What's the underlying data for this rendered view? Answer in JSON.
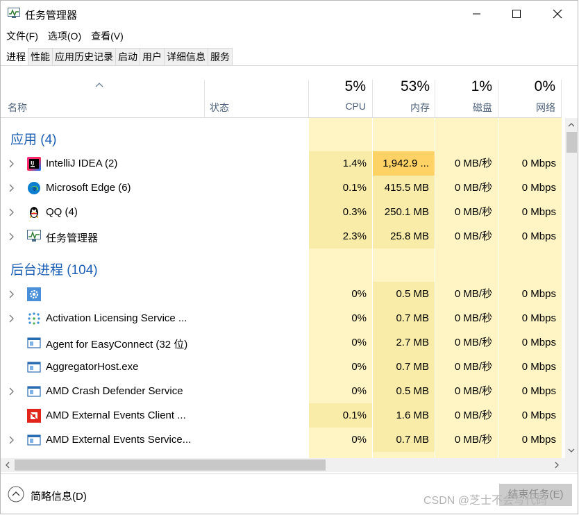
{
  "window": {
    "title": "任务管理器",
    "icon": "task-manager-icon",
    "minimize_icon": "minimize-icon",
    "maximize_icon": "maximize-icon",
    "close_icon": "close-icon"
  },
  "menu": [
    {
      "label": "文件(F)"
    },
    {
      "label": "选项(O)"
    },
    {
      "label": "查看(V)"
    }
  ],
  "tabs": [
    {
      "label": "进程",
      "active": true
    },
    {
      "label": "性能"
    },
    {
      "label": "应用历史记录"
    },
    {
      "label": "启动"
    },
    {
      "label": "用户"
    },
    {
      "label": "详细信息"
    },
    {
      "label": "服务"
    }
  ],
  "header": {
    "name": "名称",
    "status": "状态",
    "cpu_pct": "5%",
    "cpu": "CPU",
    "mem_pct": "53%",
    "mem": "内存",
    "disk_pct": "1%",
    "disk": "磁盘",
    "net_pct": "0%",
    "net": "网络"
  },
  "groups": {
    "apps": "应用 (4)",
    "background": "后台进程 (104)"
  },
  "apps": [
    {
      "name": "IntelliJ IDEA (2)",
      "icon": "intellij-idea-icon",
      "expand": true,
      "cpu": "1.4%",
      "mem": "1,942.9 ...",
      "disk": "0 MB/秒",
      "net": "0 Mbps",
      "mem_hot": true
    },
    {
      "name": "Microsoft Edge (6)",
      "icon": "edge-icon",
      "expand": true,
      "cpu": "0.1%",
      "mem": "415.5 MB",
      "disk": "0 MB/秒",
      "net": "0 Mbps"
    },
    {
      "name": "QQ (4)",
      "icon": "qq-penguin-icon",
      "expand": true,
      "cpu": "0.3%",
      "mem": "250.1 MB",
      "disk": "0 MB/秒",
      "net": "0 Mbps"
    },
    {
      "name": "任务管理器",
      "icon": "task-manager-icon",
      "expand": true,
      "cpu": "2.3%",
      "mem": "25.8 MB",
      "disk": "0 MB/秒",
      "net": "0 Mbps"
    }
  ],
  "background": [
    {
      "name": "",
      "icon": "gear-icon",
      "expand": true,
      "cpu": "0%",
      "mem": "0.5 MB",
      "disk": "0 MB/秒",
      "net": "0 Mbps"
    },
    {
      "name": "Activation Licensing Service ...",
      "icon": "dots-grid-icon",
      "expand": true,
      "cpu": "0%",
      "mem": "0.7 MB",
      "disk": "0 MB/秒",
      "net": "0 Mbps"
    },
    {
      "name": "Agent for EasyConnect (32 位)",
      "icon": "app-window-icon",
      "expand": false,
      "cpu": "0%",
      "mem": "2.7 MB",
      "disk": "0 MB/秒",
      "net": "0 Mbps"
    },
    {
      "name": "AggregatorHost.exe",
      "icon": "app-window-icon",
      "expand": false,
      "cpu": "0%",
      "mem": "0.7 MB",
      "disk": "0 MB/秒",
      "net": "0 Mbps"
    },
    {
      "name": "AMD Crash Defender Service",
      "icon": "app-window-icon",
      "expand": true,
      "cpu": "0%",
      "mem": "0.5 MB",
      "disk": "0 MB/秒",
      "net": "0 Mbps"
    },
    {
      "name": "AMD External Events Client ...",
      "icon": "amd-logo-icon",
      "expand": false,
      "cpu": "0.1%",
      "mem": "1.6 MB",
      "disk": "0 MB/秒",
      "net": "0 Mbps",
      "cpu_hot": true
    },
    {
      "name": "AMD External Events Service...",
      "icon": "app-window-icon",
      "expand": true,
      "cpu": "0%",
      "mem": "0.7 MB",
      "disk": "0 MB/秒",
      "net": "0 Mbps"
    }
  ],
  "footer": {
    "fewer_details": "简略信息(D)",
    "end_task": "结束任务(E)",
    "watermark": "CSDN @芝士不会写代码"
  },
  "colors": {
    "heat_light": "#fff4c4",
    "heat_mid": "#f9eca8",
    "heat_strong": "#ffd266",
    "group_text": "#1b5fb4"
  }
}
